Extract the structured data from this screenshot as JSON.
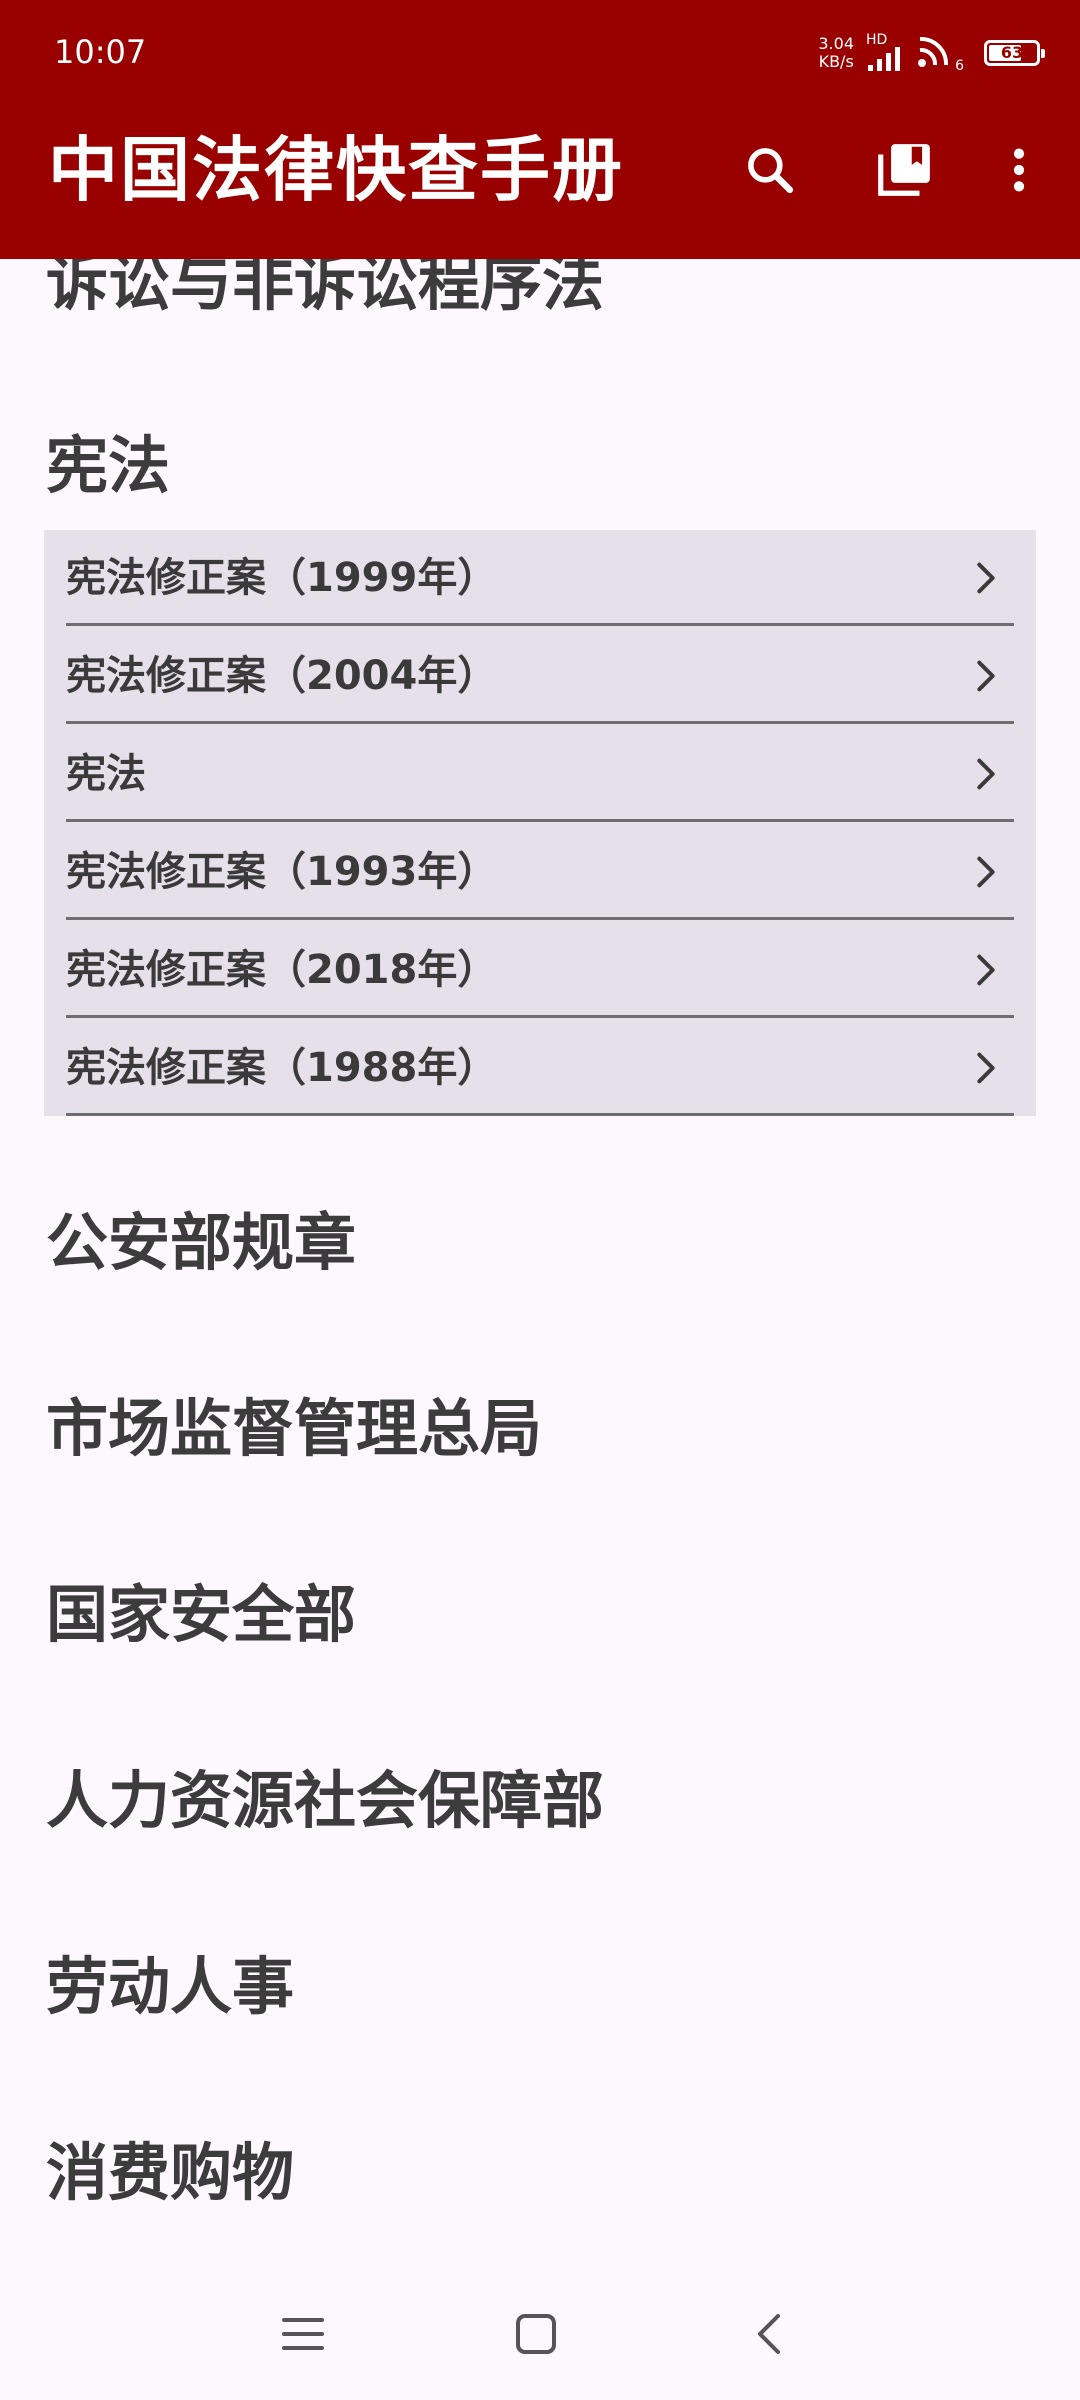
{
  "status_bar": {
    "time": "10:07",
    "net_speed_value": "3.04",
    "net_speed_unit": "KB/s",
    "signal_label": "HD",
    "wifi_badge": "6",
    "battery_level": "63"
  },
  "app_bar": {
    "title": "中国法律快查手册",
    "actions": [
      "search-icon",
      "library-icon",
      "more-vert-icon"
    ]
  },
  "categories": {
    "partial_top": "诉讼与非诉讼程序法",
    "constitution": {
      "title": "宪法",
      "items": [
        {
          "label": "宪法修正案（1999年）"
        },
        {
          "label": "宪法修正案（2004年）"
        },
        {
          "label": "宪法"
        },
        {
          "label": "宪法修正案（1993年）"
        },
        {
          "label": "宪法修正案（2018年）"
        },
        {
          "label": "宪法修正案（1988年）"
        }
      ]
    },
    "list": [
      "公安部规章",
      "市场监督管理总局",
      "国家安全部",
      "人力资源社会保障部",
      "劳动人事",
      "消费购物"
    ]
  },
  "nav_bar": {
    "buttons": [
      "menu-icon",
      "home-square-icon",
      "back-icon"
    ]
  },
  "colors": {
    "primary": "#990000",
    "panel": "#e6e0eb",
    "background": "#fdf8fd",
    "text": "#3a3a3a"
  }
}
